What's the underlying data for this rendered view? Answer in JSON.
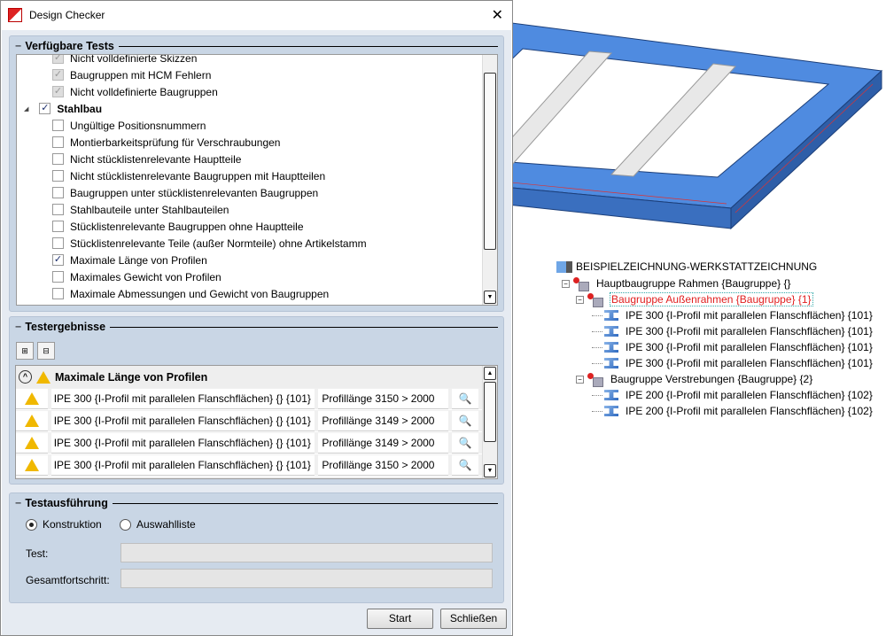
{
  "dialog": {
    "title": "Design Checker",
    "close": "✕"
  },
  "available_tests": {
    "title": "Verfügbare Tests",
    "items": [
      {
        "label": "Nicht volldefinierte Skizzen",
        "state": "disabled-checked",
        "level": 2
      },
      {
        "label": "Baugruppen mit HCM Fehlern",
        "state": "disabled-checked",
        "level": 2
      },
      {
        "label": "Nicht volldefinierte Baugruppen",
        "state": "disabled-checked",
        "level": 2
      },
      {
        "label": "Stahlbau",
        "state": "checked",
        "level": 1
      },
      {
        "label": "Ungültige Positionsnummern",
        "state": "unchecked",
        "level": 2
      },
      {
        "label": "Montierbarkeitsprüfung für Verschraubungen",
        "state": "unchecked",
        "level": 2
      },
      {
        "label": "Nicht stücklistenrelevante Hauptteile",
        "state": "unchecked",
        "level": 2
      },
      {
        "label": "Nicht stücklistenrelevante Baugruppen mit Hauptteilen",
        "state": "unchecked",
        "level": 2
      },
      {
        "label": "Baugruppen unter stücklistenrelevanten Baugruppen",
        "state": "unchecked",
        "level": 2
      },
      {
        "label": "Stahlbauteile unter Stahlbauteilen",
        "state": "unchecked",
        "level": 2
      },
      {
        "label": "Stücklistenrelevante Baugruppen ohne Hauptteile",
        "state": "unchecked",
        "level": 2
      },
      {
        "label": "Stücklistenrelevante Teile (außer Normteile) ohne Artikelstamm",
        "state": "unchecked",
        "level": 2
      },
      {
        "label": "Maximale Länge von Profilen",
        "state": "checked",
        "level": 2
      },
      {
        "label": "Maximales Gewicht von Profilen",
        "state": "unchecked",
        "level": 2
      },
      {
        "label": "Maximale Abmessungen und Gewicht von Baugruppen",
        "state": "unchecked",
        "level": 2
      }
    ]
  },
  "results": {
    "title": "Testergebnisse",
    "group": "Maximale Länge von Profilen",
    "rows": [
      {
        "part": "IPE 300 {I-Profil mit parallelen Flanschflächen} {} {101}",
        "message": "Profillänge 3150 > 2000"
      },
      {
        "part": "IPE 300 {I-Profil mit parallelen Flanschflächen} {} {101}",
        "message": "Profillänge 3149 > 2000"
      },
      {
        "part": "IPE 300 {I-Profil mit parallelen Flanschflächen} {} {101}",
        "message": "Profillänge 3149 > 2000"
      },
      {
        "part": "IPE 300 {I-Profil mit parallelen Flanschflächen} {} {101}",
        "message": "Profillänge 3150 > 2000"
      }
    ]
  },
  "execution": {
    "title": "Testausführung",
    "radio_construction": "Konstruktion",
    "radio_selection": "Auswahlliste",
    "test_label": "Test:",
    "progress_label": "Gesamtfortschritt:",
    "test_value": "",
    "progress": 0
  },
  "buttons": {
    "start": "Start",
    "close": "Schließen"
  },
  "tree": {
    "root": "BEISPIELZEICHNUNG-WERKSTATTZEICHNUNG",
    "nodes": [
      {
        "label": "Hauptbaugruppe Rahmen {Baugruppe} {}",
        "type": "assembly",
        "level": 1
      },
      {
        "label": "Baugruppe Außenrahmen {Baugruppe} {1}",
        "type": "assembly",
        "level": 2,
        "selected": true
      },
      {
        "label": "IPE 300 {I-Profil mit parallelen Flanschflächen} {101}",
        "type": "beam",
        "level": 3
      },
      {
        "label": "IPE 300 {I-Profil mit parallelen Flanschflächen} {101}",
        "type": "beam",
        "level": 3
      },
      {
        "label": "IPE 300 {I-Profil mit parallelen Flanschflächen} {101}",
        "type": "beam",
        "level": 3
      },
      {
        "label": "IPE 300 {I-Profil mit parallelen Flanschflächen} {101}",
        "type": "beam",
        "level": 3
      },
      {
        "label": "Baugruppe Verstrebungen {Baugruppe} {2}",
        "type": "assembly",
        "level": 2
      },
      {
        "label": "IPE 200 {I-Profil mit parallelen Flanschflächen} {102}",
        "type": "beam",
        "level": 3
      },
      {
        "label": "IPE 200 {I-Profil mit parallelen Flanschflächen} {102}",
        "type": "beam",
        "level": 3
      }
    ]
  },
  "colors": {
    "frame": "#4a86d8",
    "selected_text": "#e02020"
  }
}
